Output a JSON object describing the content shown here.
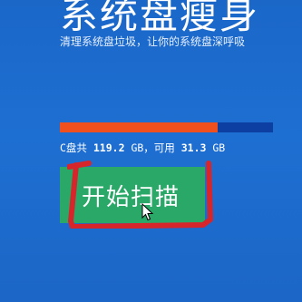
{
  "header": {
    "title": "系统盘瘦身",
    "subtitle": "清理系统盘垃圾，让你的系统盘深呼吸"
  },
  "disk": {
    "label": "C盘共",
    "total": "119.2",
    "total_unit": "GB，可用",
    "free": "31.3",
    "free_unit": "GB",
    "used_fraction": 0.74
  },
  "actions": {
    "scan_label": "开始扫描"
  },
  "colors": {
    "background": "#1e6fd2",
    "bar_used": "#f0501e",
    "bar_track": "#0d3fa3",
    "button": "#2aa868",
    "annotation": "#d7262b"
  },
  "icons": {
    "cursor": "mouse-pointer-icon"
  }
}
